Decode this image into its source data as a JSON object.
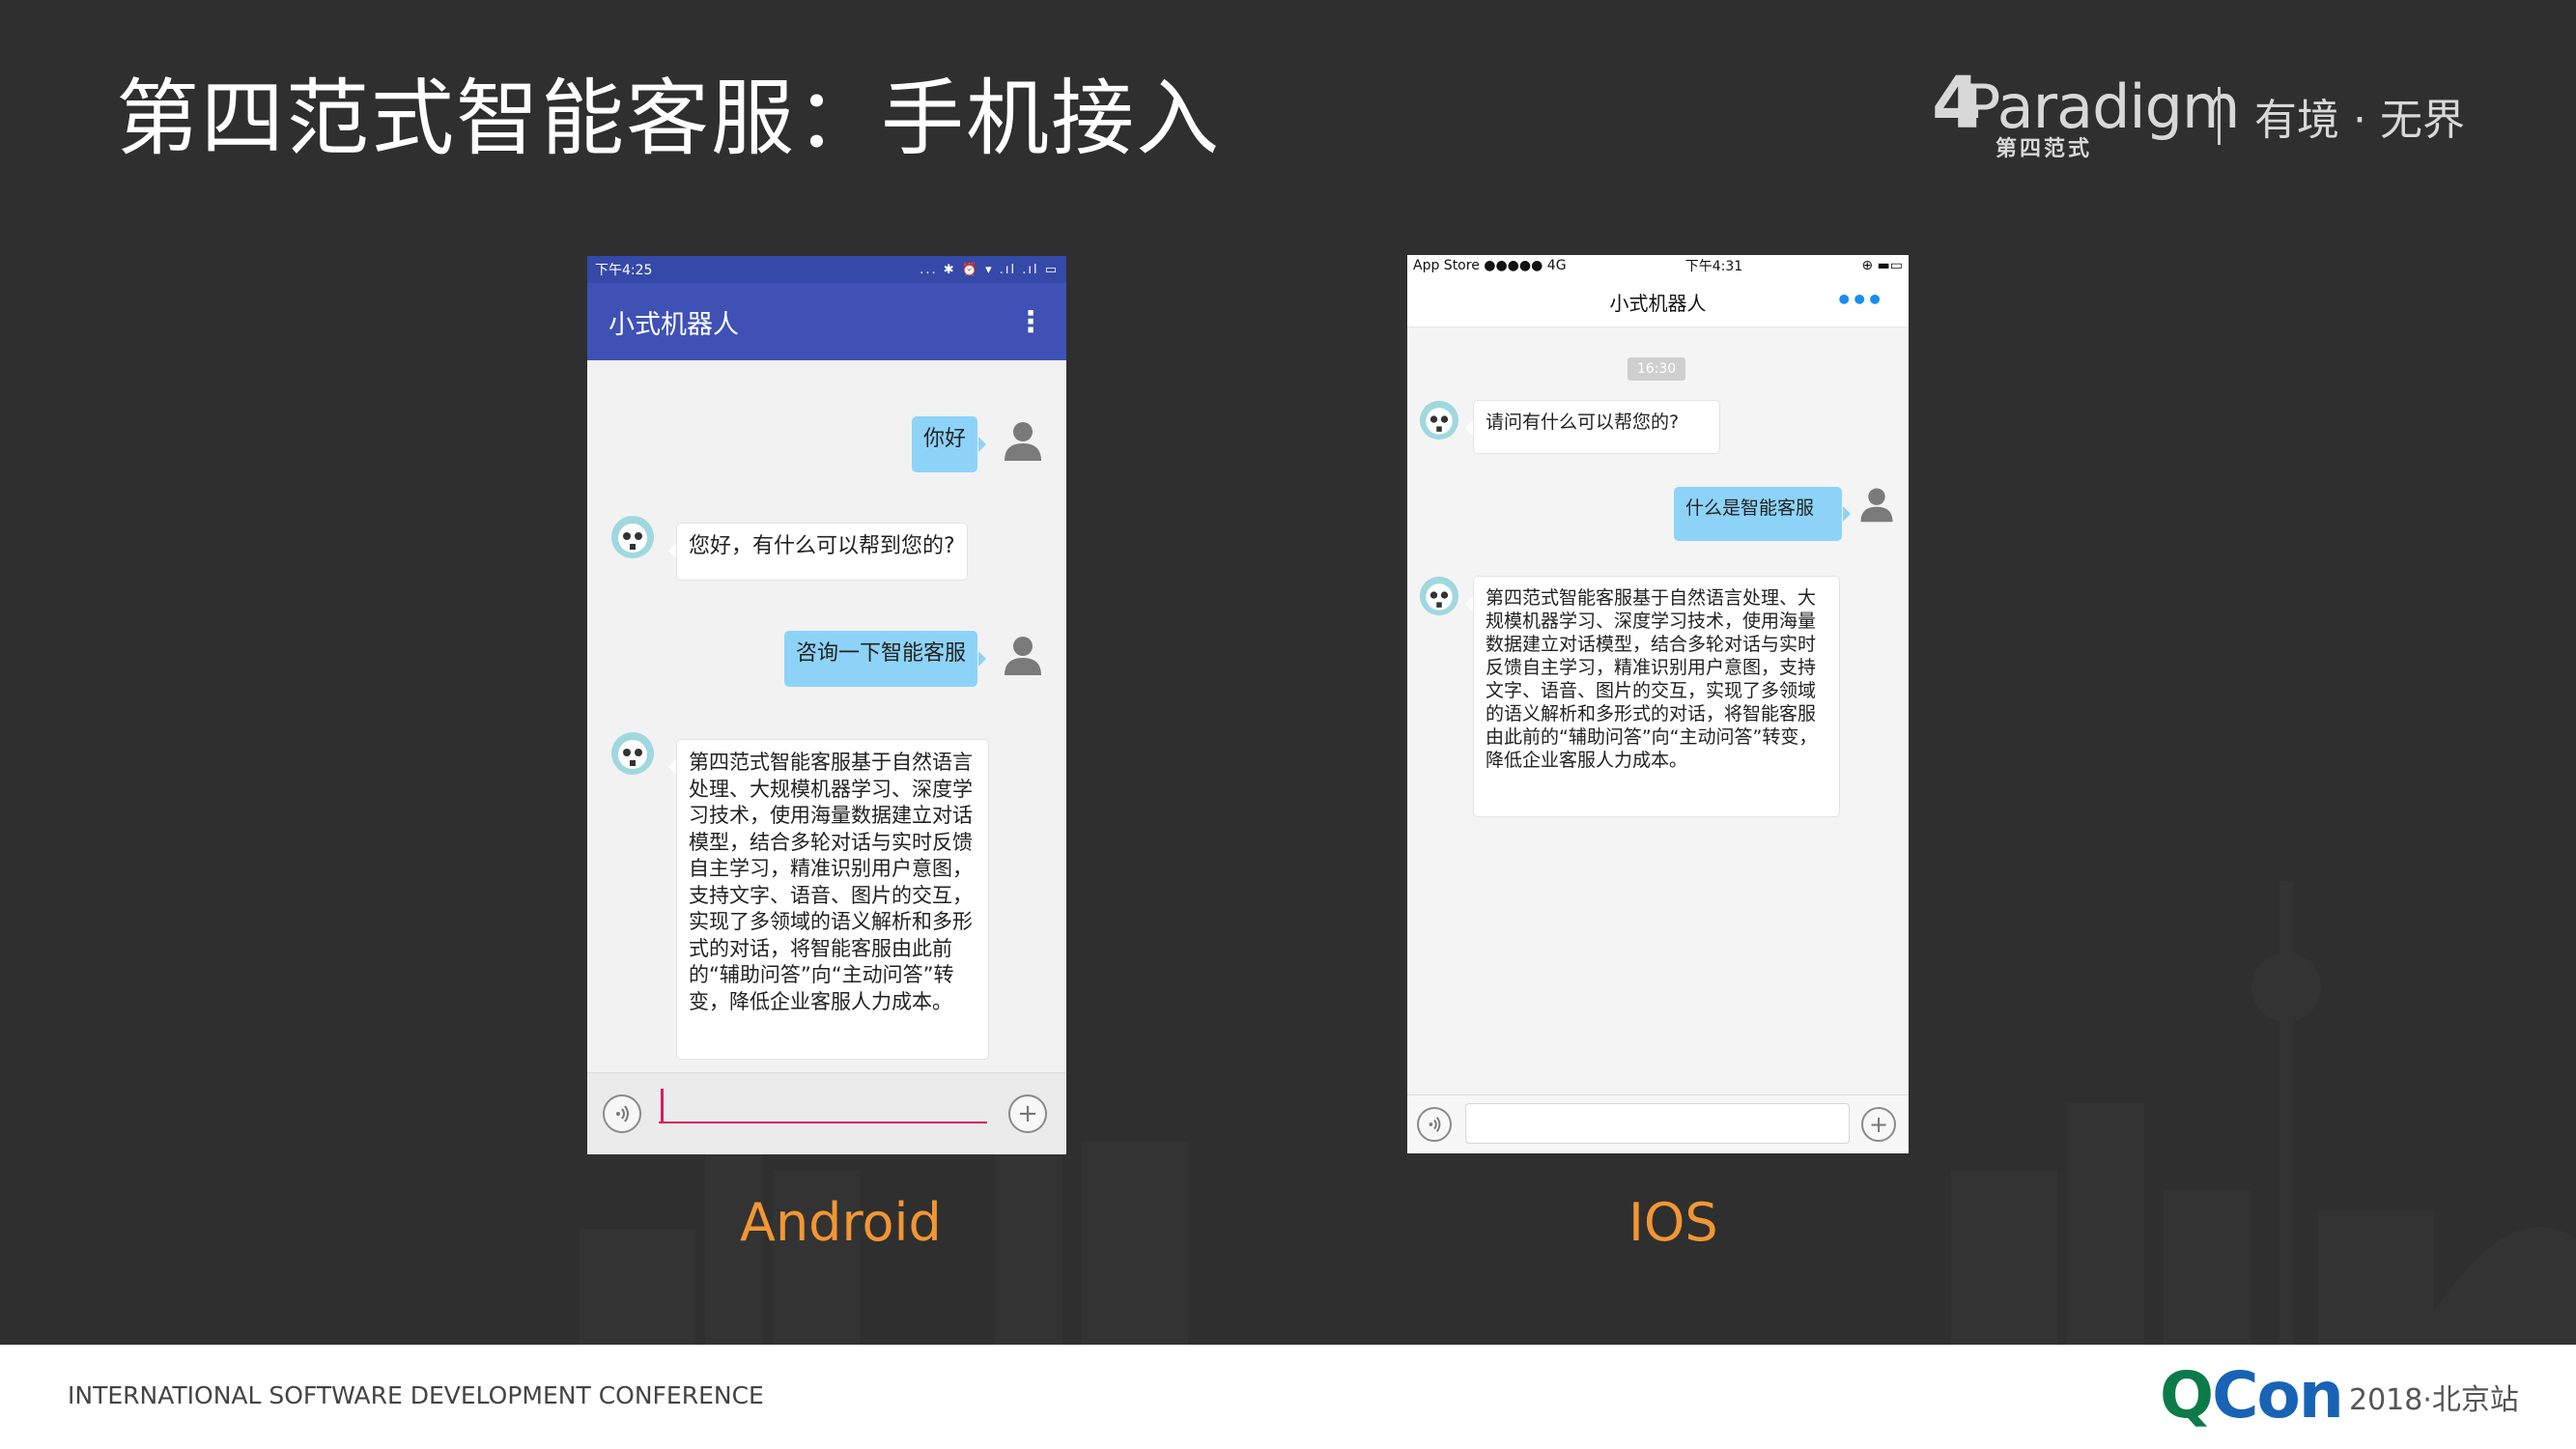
{
  "slide": {
    "title": "第四范式智能客服：手机接入",
    "brand_text": "Paradigm",
    "brand_mark": "4",
    "brand_sub": "第四范式",
    "slogan": "有境 · 无界"
  },
  "android": {
    "status_time": "下午4:25",
    "status_icons": "... ✱ ⏰ ▾ .ıl .ıl ▭",
    "toolbar_title": "小式机器人",
    "menu_icon": "⋮",
    "messages": [
      {
        "from": "user",
        "text": "你好"
      },
      {
        "from": "bot",
        "text": "您好，有什么可以帮到您的?"
      },
      {
        "from": "user",
        "text": "咨询一下智能客服"
      },
      {
        "from": "bot",
        "text": "第四范式智能客服基于自然语言处理、大规模机器学习、深度学习技术，使用海量数据建立对话模型，结合多轮对话与实时反馈自主学习，精准识别用户意图，支持文字、语音、图片的交互，实现了多领域的语义解析和多形式的对话，将智能客服由此前的“辅助问答”向“主动问答”转变，降低企业客服人力成本。"
      }
    ],
    "caption": "Android"
  },
  "ios": {
    "status_left": "App Store ●●●●● 4G",
    "status_time": "下午4:31",
    "status_right": "⊕ ▬▭",
    "nav_title": "小式机器人",
    "more_icon": "•••",
    "timestamp": "16:30",
    "messages": [
      {
        "from": "bot",
        "text": "请问有什么可以帮您的?"
      },
      {
        "from": "user",
        "text": "什么是智能客服"
      },
      {
        "from": "bot",
        "text": "第四范式智能客服基于自然语言处理、大规模机器学习、深度学习技术，使用海量数据建立对话模型，结合多轮对话与实时反馈自主学习，精准识别用户意图，支持文字、语音、图片的交互，实现了多领域的语义解析和多形式的对话，将智能客服由此前的“辅助问答”向“主动问答”转变，降低企业客服人力成本。"
      }
    ],
    "caption": "IOS"
  },
  "footer": {
    "conference": "INTERNATIONAL SOFTWARE DEVELOPMENT CONFERENCE",
    "qcon_q": "Q",
    "qcon_rest": "Con",
    "event": "2018·北京站"
  },
  "colors": {
    "slide_bg": "#2f2f2f",
    "android_toolbar": "#3f51b5",
    "user_bubble": "#8dd3f7",
    "caption": "#f29634",
    "qcon_green": "#0d7a4a",
    "qcon_blue": "#1863b5"
  },
  "icons": {
    "voice": "voice-icon",
    "add": "plus-icon",
    "user_avatar": "user-avatar-icon",
    "bot_avatar": "panda-robot-avatar"
  }
}
